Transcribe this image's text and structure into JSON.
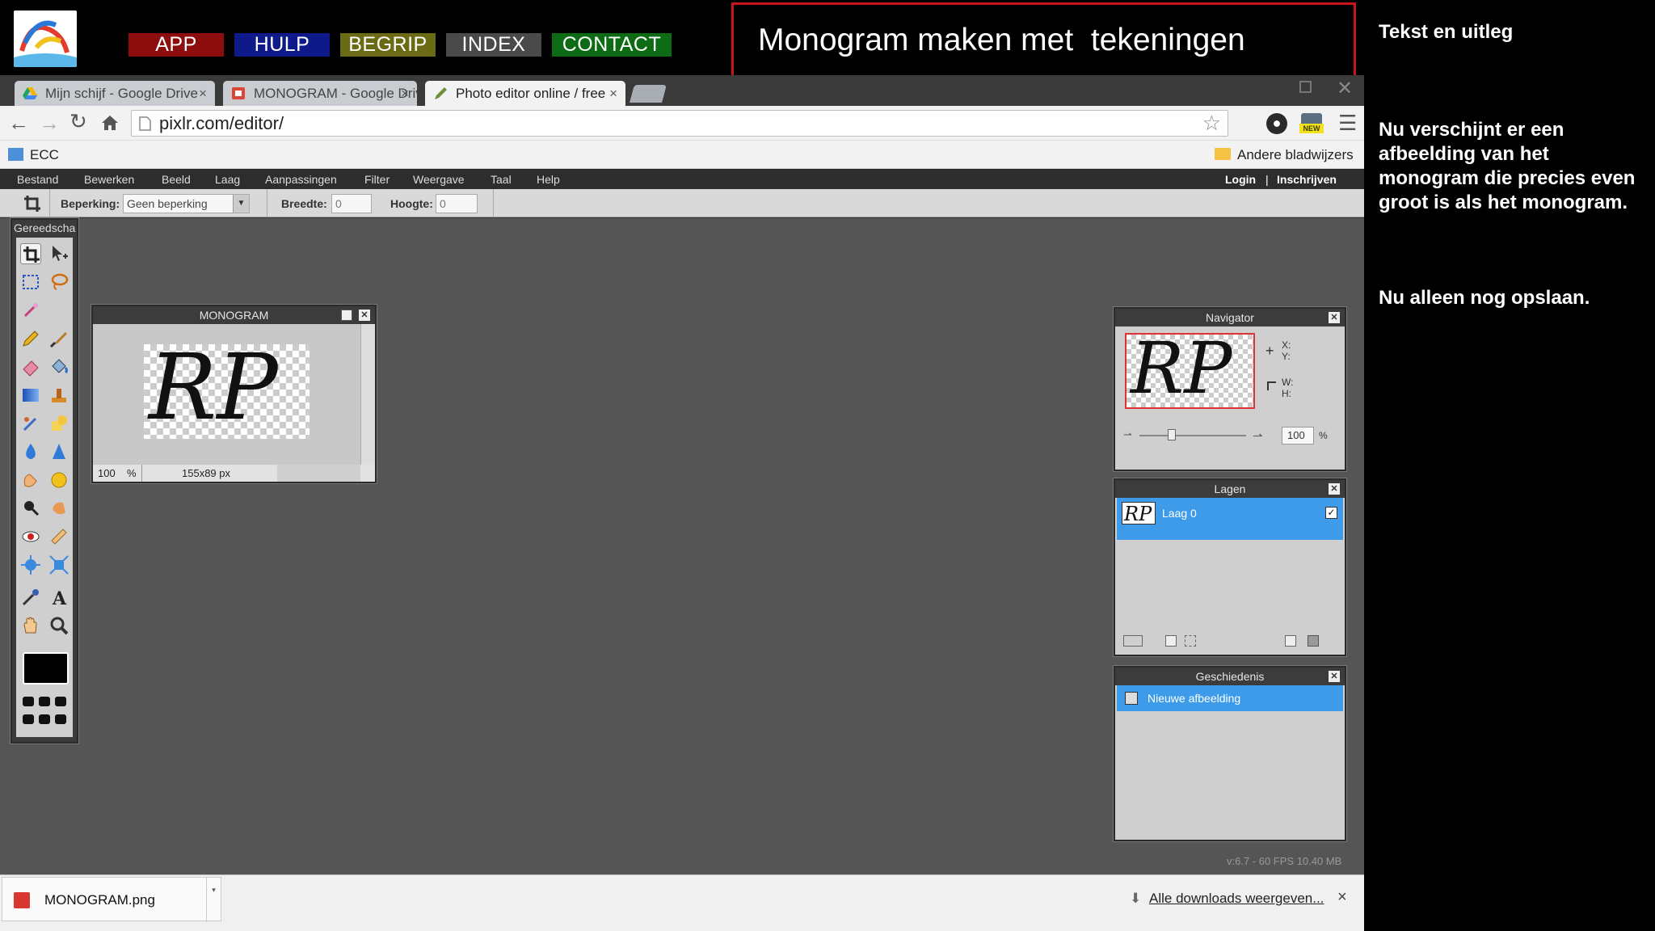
{
  "site": {
    "nav": [
      {
        "label": "APP",
        "color": "#8b0d0d"
      },
      {
        "label": "HULP",
        "color": "#0f1a8a"
      },
      {
        "label": "BEGRIP",
        "color": "#6b6b16"
      },
      {
        "label": "INDEX",
        "color": "#4a4a4a"
      },
      {
        "label": "CONTACT",
        "color": "#0c6b14"
      }
    ],
    "title": "Monogram maken met  tekeningen",
    "side_heading": "Tekst en uitleg",
    "side_text_1": "Nu verschijnt er een afbeelding van het monogram die precies even groot is als het monogram.",
    "side_text_2": "Nu alleen nog opslaan."
  },
  "browser": {
    "tabs": [
      {
        "label": "Mijn schijf - Google Drive"
      },
      {
        "label": "MONOGRAM - Google Drive"
      },
      {
        "label": "Photo editor online / free"
      }
    ],
    "url": "pixlr.com/editor/",
    "bookmark_ecc": "ECC",
    "bookmark_other": "Andere bladwijzers",
    "badge": "NEW"
  },
  "pixlr": {
    "menu": [
      "Bestand",
      "Bewerken",
      "Beeld",
      "Laag",
      "Aanpassingen",
      "Filter",
      "Weergave",
      "Taal",
      "Help"
    ],
    "login": "Login",
    "separator": "|",
    "signup": "Inschrijven",
    "options": {
      "beperking_label": "Beperking:",
      "beperking_value": "Geen beperking",
      "breedte_label": "Breedte:",
      "breedte_value": "0",
      "hoogte_label": "Hoogte:",
      "hoogte_value": "0"
    },
    "tools_title": "Gereedscha",
    "doc": {
      "title": "MONOGRAM",
      "zoom": "100",
      "percent": "%",
      "size": "155x89 px",
      "monogram": "RP"
    },
    "navigator": {
      "title": "Navigator",
      "x": "X:",
      "y": "Y:",
      "w": "W:",
      "h": "H:",
      "zoom": "100",
      "percent": "%",
      "zoom_slider_fraction": 0.3
    },
    "layers": {
      "title": "Lagen",
      "items": [
        {
          "name": "Laag 0",
          "visible": true
        }
      ]
    },
    "history": {
      "title": "Geschiedenis",
      "items": [
        "Nieuwe afbeelding"
      ]
    },
    "version": "v:6.7 - 60 FPS 10.40 MB"
  },
  "downloads": {
    "file": "MONOGRAM.png",
    "all_link": "Alle downloads weergeven..."
  }
}
